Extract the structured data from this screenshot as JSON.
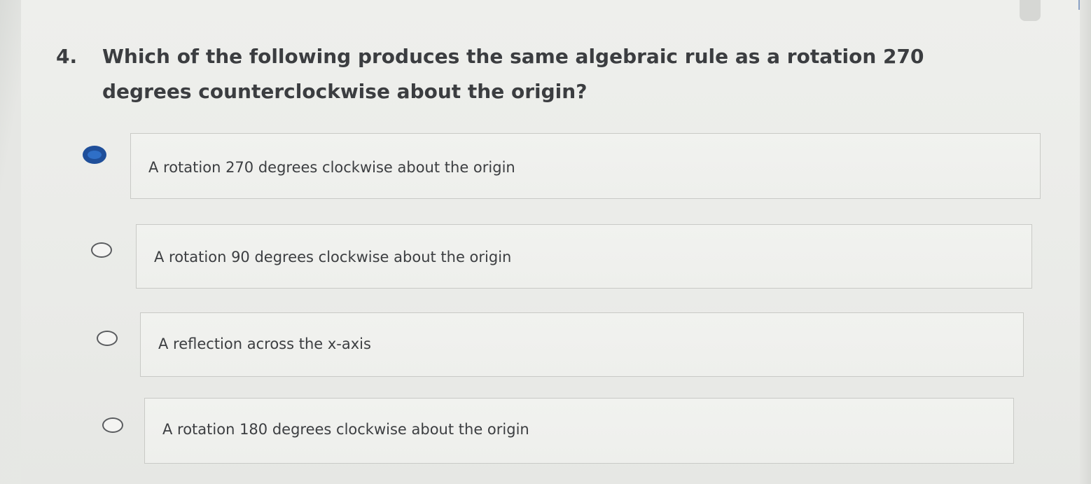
{
  "question": {
    "number": "4.",
    "text": "Which of the following produces the same algebraic rule as a rotation 270 degrees counterclockwise about the origin?"
  },
  "options": [
    {
      "label": "A rotation 270 degrees clockwise about the origin",
      "selected": true
    },
    {
      "label": "A rotation 90 degrees clockwise about the origin",
      "selected": false
    },
    {
      "label": "A reflection across the x-axis",
      "selected": false
    },
    {
      "label": "A rotation 180 degrees clockwise about the origin",
      "selected": false
    }
  ],
  "colors": {
    "selected_radio": "#2f6fc7",
    "text": "#3b3d40",
    "box_border": "#c9cac6"
  }
}
